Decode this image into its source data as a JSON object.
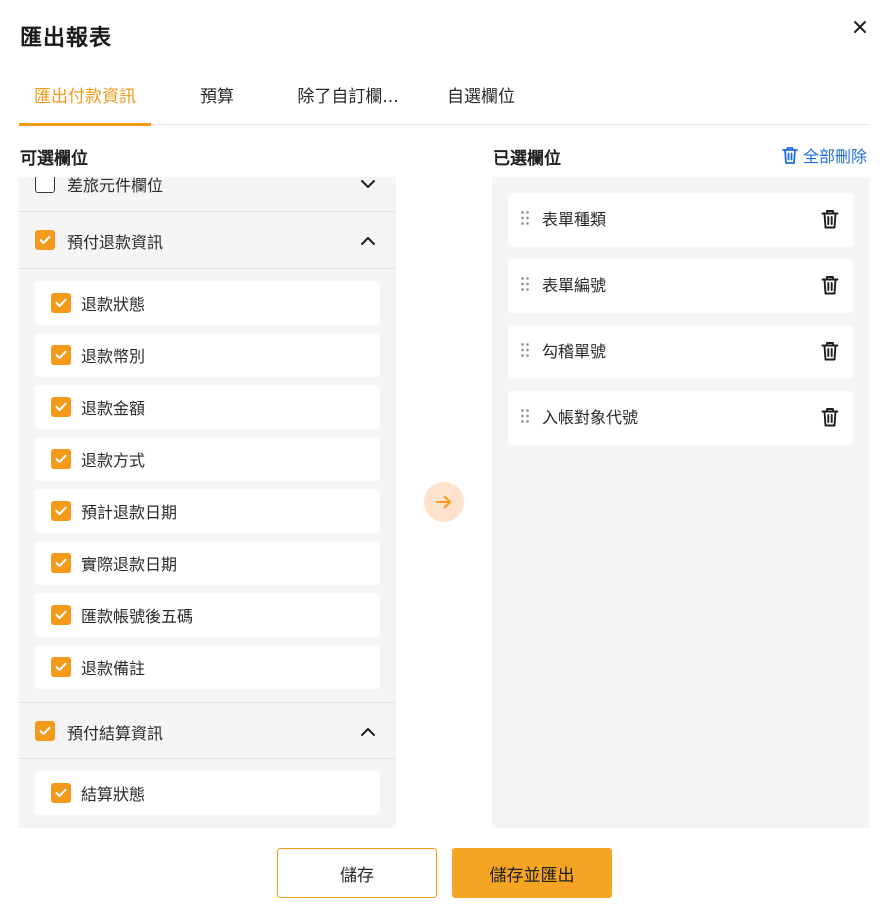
{
  "dialog": {
    "title": "匯出報表"
  },
  "tabs": [
    {
      "label": "匯出付款資訊",
      "active": true
    },
    {
      "label": "預算",
      "active": false
    },
    {
      "label": "除了自訂欄...",
      "active": false
    },
    {
      "label": "自選欄位",
      "active": false
    }
  ],
  "available": {
    "title": "可選欄位",
    "groups": [
      {
        "label": "差旅元件欄位",
        "checked": false,
        "expanded": false,
        "items": []
      },
      {
        "label": "預付退款資訊",
        "checked": true,
        "expanded": true,
        "items": [
          {
            "label": "退款狀態",
            "checked": true
          },
          {
            "label": "退款幣別",
            "checked": true
          },
          {
            "label": "退款金額",
            "checked": true
          },
          {
            "label": "退款方式",
            "checked": true
          },
          {
            "label": "預計退款日期",
            "checked": true
          },
          {
            "label": "實際退款日期",
            "checked": true
          },
          {
            "label": "匯款帳號後五碼",
            "checked": true
          },
          {
            "label": "退款備註",
            "checked": true
          }
        ]
      },
      {
        "label": "預付結算資訊",
        "checked": true,
        "expanded": true,
        "items": [
          {
            "label": "結算狀態",
            "checked": true
          }
        ]
      }
    ]
  },
  "selected": {
    "title": "已選欄位",
    "delete_all_label": "全部刪除",
    "items": [
      {
        "label": "表單種類"
      },
      {
        "label": "表單編號"
      },
      {
        "label": "勾稽單號"
      },
      {
        "label": "入帳對象代號"
      }
    ]
  },
  "buttons": {
    "save_label": "儲存",
    "save_export_label": "儲存並匯出"
  },
  "colors": {
    "accent": "#f39a1b",
    "link": "#1e6fd9",
    "panel_bg": "#f5f5f5"
  }
}
